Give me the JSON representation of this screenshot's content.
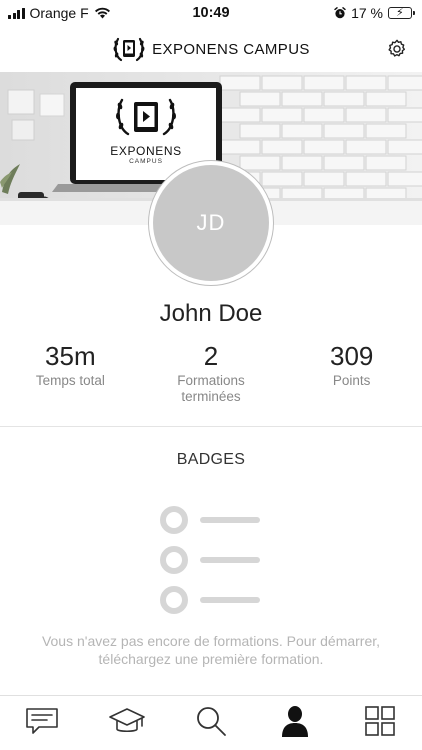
{
  "status_bar": {
    "carrier": "Orange F",
    "time": "10:49",
    "battery_text": "17 %",
    "battery_level_percent": 17
  },
  "header": {
    "brand_name": "EXPONENS CAMPUS",
    "settings_icon": "gear-icon"
  },
  "banner": {
    "logo_main": "EXPONENS",
    "logo_sub": "CAMPUS"
  },
  "profile": {
    "initials": "JD",
    "name": "John Doe"
  },
  "stats": [
    {
      "value": "35m",
      "label": "Temps total"
    },
    {
      "value": "2",
      "label": "Formations terminées"
    },
    {
      "value": "309",
      "label": "Points"
    }
  ],
  "badges": {
    "title": "BADGES",
    "empty_message": "Vous n'avez pas encore de formations. Pour démarrer, téléchargez une première formation."
  },
  "tab_bar": {
    "tabs": [
      {
        "icon": "chat-icon",
        "active": false
      },
      {
        "icon": "graduation-cap-icon",
        "active": false
      },
      {
        "icon": "search-icon",
        "active": false
      },
      {
        "icon": "profile-icon",
        "active": true
      },
      {
        "icon": "grid-icon",
        "active": false
      }
    ]
  },
  "colors": {
    "accent": "#222222",
    "muted_text": "#888888",
    "placeholder": "#d6d6d6",
    "battery_low": "#e8342b"
  }
}
